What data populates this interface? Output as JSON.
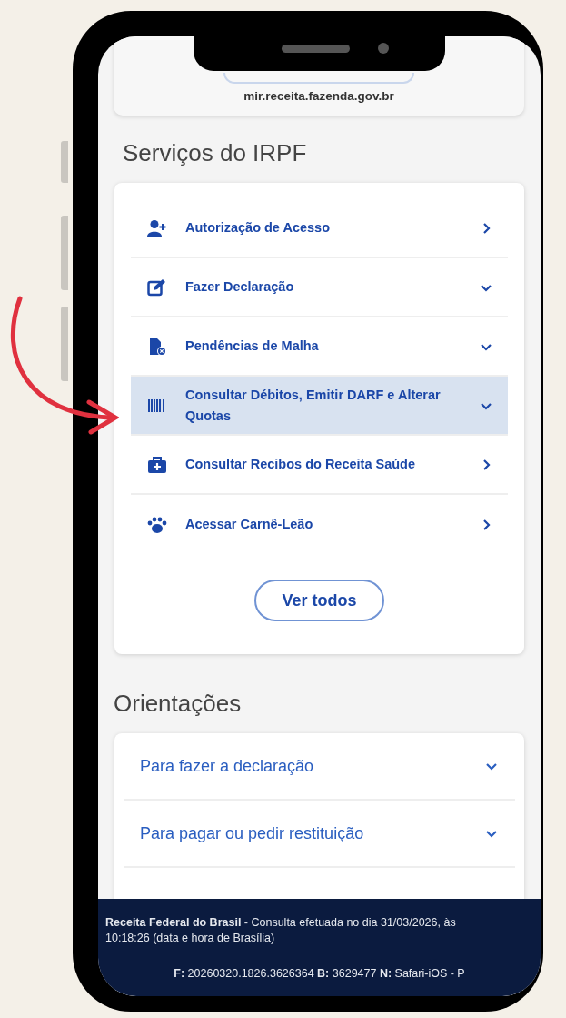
{
  "top_card": {
    "url": "mir.receita.fazenda.gov.br"
  },
  "services": {
    "title": "Serviços do IRPF",
    "items": [
      {
        "label": "Autorização de Acesso",
        "kind": "link",
        "selected": false
      },
      {
        "label": "Fazer Declaração",
        "kind": "accordion",
        "selected": false
      },
      {
        "label": "Pendências de Malha",
        "kind": "accordion",
        "selected": false
      },
      {
        "label": "Consultar Débitos, Emitir DARF e Alterar Quotas",
        "kind": "accordion",
        "selected": true
      },
      {
        "label": "Consultar Recibos do Receita Saúde",
        "kind": "link",
        "selected": false
      },
      {
        "label": "Acessar Carnê-Leão",
        "kind": "link",
        "selected": false
      }
    ],
    "button": "Ver todos"
  },
  "guidance": {
    "title": "Orientações",
    "items": [
      {
        "label": "Para fazer a declaração"
      },
      {
        "label": "Para pagar ou pedir restituição"
      }
    ]
  },
  "footer": {
    "line_1": "**Receita Federal do Brasil** - Consulta efetuada no dia 31/03/2026, às 10:18:26 (data e hora de Brasília)",
    "line_2": "**F:** 20260320.1826.3626364 **B:** 3629477 **N:** Safari-iOS - P"
  }
}
